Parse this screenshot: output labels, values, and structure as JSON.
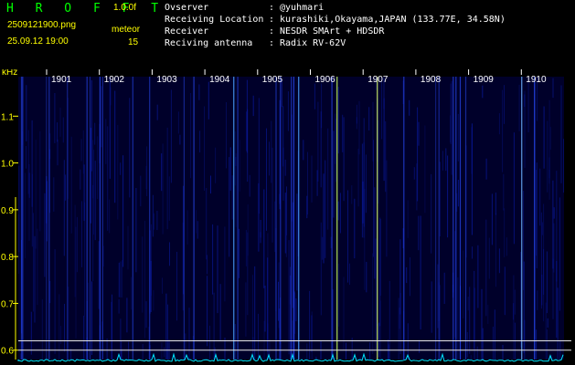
{
  "colors": {
    "accent": "#00ff00",
    "text": "#ffffff",
    "ytext": "#ffff00",
    "wf_dark": "#00002a",
    "wf_mid": "#0a1aa0",
    "trace": "#00e5ff"
  },
  "header": {
    "brand": "H R O F F T",
    "version": "1.0.0f",
    "filename": "2509121900.png",
    "timestamp": "25.09.12 19:00",
    "mode_label": "meteor",
    "count": "15"
  },
  "info": [
    {
      "key": "Ovserver",
      "sep": ":",
      "value": "@yuhmari"
    },
    {
      "key": "Receiving Location",
      "sep": ":",
      "value": "kurashiki,Okayama,JAPAN (133.77E, 34.58N)"
    },
    {
      "key": "Receiver",
      "sep": ":",
      "value": "NESDR SMArt + HDSDR"
    },
    {
      "key": "Reciving antenna",
      "sep": ":",
      "value": "Radix RV-62V"
    }
  ],
  "chart_data": {
    "type": "heatmap",
    "ylabel": "kHz",
    "ylim": [
      0.58,
      1.2
    ],
    "yticks": [
      {
        "v": 0.6,
        "label": "0.6"
      },
      {
        "v": 0.7,
        "label": "0.7"
      },
      {
        "v": 0.8,
        "label": "0.8"
      },
      {
        "v": 0.9,
        "label": "0.9"
      },
      {
        "v": 1.0,
        "label": "1.0"
      },
      {
        "v": 1.1,
        "label": "1.1"
      }
    ],
    "xlabels": [
      "1901",
      "1902",
      "1903",
      "1904",
      "1905",
      "1906",
      "1907",
      "1908",
      "1909",
      "1910"
    ],
    "reference_lines": [
      0.62,
      0.6
    ]
  }
}
